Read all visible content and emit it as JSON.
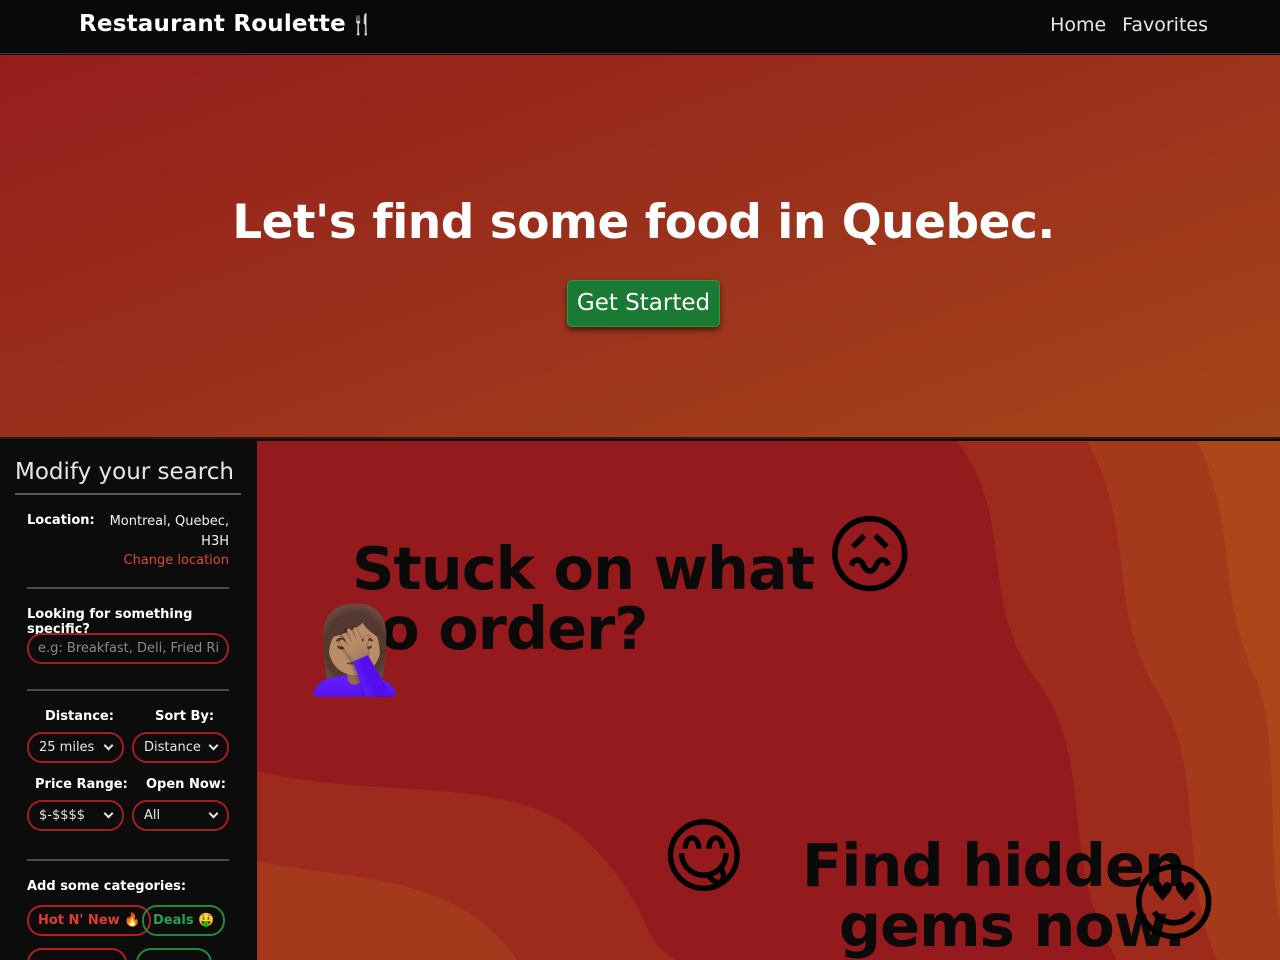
{
  "navbar": {
    "brand": "Restaurant Roulette",
    "links": [
      "Home",
      "Favorites"
    ]
  },
  "hero": {
    "title": "Let's find some food in Quebec.",
    "cta_label": "Get Started"
  },
  "sidebar": {
    "heading": "Modify your search",
    "location_label": "Location:",
    "location_value": "Montreal, Quebec, H3H",
    "change_location": "Change location",
    "specific_label": "Looking for something specific?",
    "search_placeholder": "e.g: Breakfast, Deli, Fried Rice",
    "distance_label": "Distance:",
    "distance_value": "25 miles",
    "sort_label": "Sort By:",
    "sort_value": "Distance",
    "price_label": "Price Range:",
    "price_value": "$-$$$$",
    "open_label": "Open Now:",
    "open_value": "All",
    "categories_label": "Add some categories:",
    "categories": [
      {
        "label": "Hot N' New",
        "emoji": "🔥",
        "color": "red"
      },
      {
        "label": "Deals",
        "emoji": "🤑",
        "color": "green"
      }
    ]
  },
  "feature": {
    "title_1": "Stuck on what to order?",
    "title_2": "Find hidden gems now."
  },
  "colors": {
    "hero_red": "#971d1d",
    "hero_orange": "#a5451a",
    "cta_green": "#1a7a34",
    "accent_red": "#e2463a",
    "panel_red": "#941a1d"
  }
}
